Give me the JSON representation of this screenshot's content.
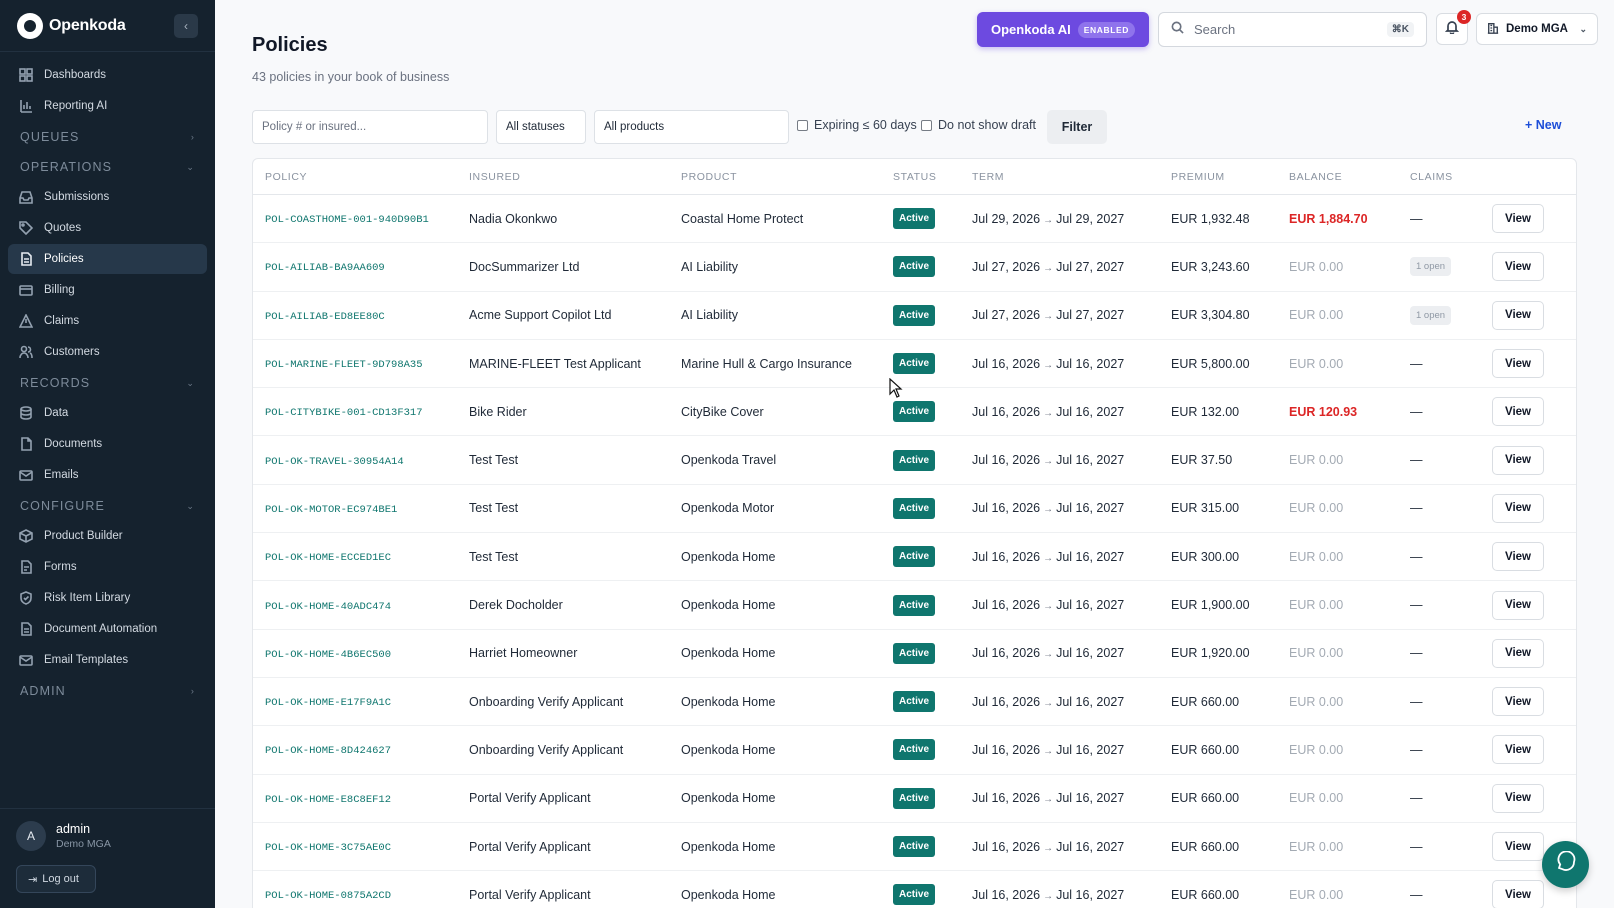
{
  "brand": {
    "name": "Openkoda"
  },
  "sidebar": {
    "top_items": [
      {
        "label": "Dashboards",
        "icon": "grid-icon"
      },
      {
        "label": "Reporting AI",
        "icon": "bar-chart-icon"
      }
    ],
    "sections": {
      "queues": "QUEUES",
      "operations": "OPERATIONS",
      "records": "RECORDS",
      "configure": "CONFIGURE",
      "admin": "ADMIN"
    },
    "operations_items": [
      {
        "label": "Submissions",
        "icon": "inbox-icon"
      },
      {
        "label": "Quotes",
        "icon": "tag-icon"
      },
      {
        "label": "Policies",
        "icon": "file-icon",
        "active": true
      },
      {
        "label": "Billing",
        "icon": "card-icon"
      },
      {
        "label": "Claims",
        "icon": "warning-icon"
      },
      {
        "label": "Customers",
        "icon": "users-icon"
      }
    ],
    "records_items": [
      {
        "label": "Data",
        "icon": "database-icon"
      },
      {
        "label": "Documents",
        "icon": "document-icon"
      },
      {
        "label": "Emails",
        "icon": "mail-icon"
      }
    ],
    "configure_items": [
      {
        "label": "Product Builder",
        "icon": "box-icon"
      },
      {
        "label": "Forms",
        "icon": "form-icon"
      },
      {
        "label": "Risk Item Library",
        "icon": "shield-icon"
      },
      {
        "label": "Document Automation",
        "icon": "doc-auto-icon"
      },
      {
        "label": "Email Templates",
        "icon": "mail-template-icon"
      }
    ],
    "user": {
      "initial": "A",
      "name": "admin",
      "org": "Demo MGA",
      "logout": "Log out"
    }
  },
  "header": {
    "title": "Policies",
    "subtitle": "43 policies in your book of business",
    "ai_button": "Openkoda AI",
    "ai_badge": "ENABLED",
    "search_placeholder": "Search",
    "search_shortcut": "⌘K",
    "notification_count": "3",
    "org_switcher": "Demo MGA"
  },
  "filters": {
    "search_placeholder": "Policy # or insured...",
    "status_select": "All statuses",
    "product_select": "All products",
    "expiring_label": "Expiring ≤ 60 days",
    "no_draft_label": "Do not show draft",
    "filter_button": "Filter",
    "new_button": "+ New"
  },
  "table": {
    "headers": [
      "POLICY",
      "INSURED",
      "PRODUCT",
      "STATUS",
      "TERM",
      "PREMIUM",
      "BALANCE",
      "CLAIMS"
    ],
    "view_label": "View",
    "rows": [
      {
        "policy": "POL-COASTHOME-001-940D90B1",
        "insured": "Nadia Okonkwo",
        "product": "Coastal Home Protect",
        "status": "Active",
        "start": "Jul 29, 2026",
        "end": "Jul 29, 2027",
        "premium": "EUR 1,932.48",
        "balance": "EUR 1,884.70",
        "balance_due": true,
        "claims": "—"
      },
      {
        "policy": "POL-AILIAB-BA9AA609",
        "insured": "DocSummarizer Ltd",
        "product": "AI Liability",
        "status": "Active",
        "start": "Jul 27, 2026",
        "end": "Jul 27, 2027",
        "premium": "EUR 3,243.60",
        "balance": "EUR 0.00",
        "balance_due": false,
        "claims": "1 open"
      },
      {
        "policy": "POL-AILIAB-ED8EE80C",
        "insured": "Acme Support Copilot Ltd",
        "product": "AI Liability",
        "status": "Active",
        "start": "Jul 27, 2026",
        "end": "Jul 27, 2027",
        "premium": "EUR 3,304.80",
        "balance": "EUR 0.00",
        "balance_due": false,
        "claims": "1 open"
      },
      {
        "policy": "POL-MARINE-FLEET-9D798A35",
        "insured": "MARINE-FLEET Test Applicant",
        "product": "Marine Hull & Cargo Insurance",
        "status": "Active",
        "start": "Jul 16, 2026",
        "end": "Jul 16, 2027",
        "premium": "EUR 5,800.00",
        "balance": "EUR 0.00",
        "balance_due": false,
        "claims": "—"
      },
      {
        "policy": "POL-CITYBIKE-001-CD13F317",
        "insured": "Bike Rider",
        "product": "CityBike Cover",
        "status": "Active",
        "start": "Jul 16, 2026",
        "end": "Jul 16, 2027",
        "premium": "EUR 132.00",
        "balance": "EUR 120.93",
        "balance_due": true,
        "claims": "—"
      },
      {
        "policy": "POL-OK-TRAVEL-30954A14",
        "insured": "Test Test",
        "product": "Openkoda Travel",
        "status": "Active",
        "start": "Jul 16, 2026",
        "end": "Jul 16, 2027",
        "premium": "EUR 37.50",
        "balance": "EUR 0.00",
        "balance_due": false,
        "claims": "—"
      },
      {
        "policy": "POL-OK-MOTOR-EC974BE1",
        "insured": "Test Test",
        "product": "Openkoda Motor",
        "status": "Active",
        "start": "Jul 16, 2026",
        "end": "Jul 16, 2027",
        "premium": "EUR 315.00",
        "balance": "EUR 0.00",
        "balance_due": false,
        "claims": "—"
      },
      {
        "policy": "POL-OK-HOME-ECCED1EC",
        "insured": "Test Test",
        "product": "Openkoda Home",
        "status": "Active",
        "start": "Jul 16, 2026",
        "end": "Jul 16, 2027",
        "premium": "EUR 300.00",
        "balance": "EUR 0.00",
        "balance_due": false,
        "claims": "—"
      },
      {
        "policy": "POL-OK-HOME-40ADC474",
        "insured": "Derek Docholder",
        "product": "Openkoda Home",
        "status": "Active",
        "start": "Jul 16, 2026",
        "end": "Jul 16, 2027",
        "premium": "EUR 1,900.00",
        "balance": "EUR 0.00",
        "balance_due": false,
        "claims": "—"
      },
      {
        "policy": "POL-OK-HOME-4B6EC500",
        "insured": "Harriet Homeowner",
        "product": "Openkoda Home",
        "status": "Active",
        "start": "Jul 16, 2026",
        "end": "Jul 16, 2027",
        "premium": "EUR 1,920.00",
        "balance": "EUR 0.00",
        "balance_due": false,
        "claims": "—"
      },
      {
        "policy": "POL-OK-HOME-E17F9A1C",
        "insured": "Onboarding Verify Applicant",
        "product": "Openkoda Home",
        "status": "Active",
        "start": "Jul 16, 2026",
        "end": "Jul 16, 2027",
        "premium": "EUR 660.00",
        "balance": "EUR 0.00",
        "balance_due": false,
        "claims": "—"
      },
      {
        "policy": "POL-OK-HOME-8D424627",
        "insured": "Onboarding Verify Applicant",
        "product": "Openkoda Home",
        "status": "Active",
        "start": "Jul 16, 2026",
        "end": "Jul 16, 2027",
        "premium": "EUR 660.00",
        "balance": "EUR 0.00",
        "balance_due": false,
        "claims": "—"
      },
      {
        "policy": "POL-OK-HOME-E8C8EF12",
        "insured": "Portal Verify Applicant",
        "product": "Openkoda Home",
        "status": "Active",
        "start": "Jul 16, 2026",
        "end": "Jul 16, 2027",
        "premium": "EUR 660.00",
        "balance": "EUR 0.00",
        "balance_due": false,
        "claims": "—"
      },
      {
        "policy": "POL-OK-HOME-3C75AE0C",
        "insured": "Portal Verify Applicant",
        "product": "Openkoda Home",
        "status": "Active",
        "start": "Jul 16, 2026",
        "end": "Jul 16, 2027",
        "premium": "EUR 660.00",
        "balance": "EUR 0.00",
        "balance_due": false,
        "claims": "—"
      },
      {
        "policy": "POL-OK-HOME-0875A2CD",
        "insured": "Portal Verify Applicant",
        "product": "Openkoda Home",
        "status": "Active",
        "start": "Jul 16, 2026",
        "end": "Jul 16, 2027",
        "premium": "EUR 660.00",
        "balance": "EUR 0.00",
        "balance_due": false,
        "claims": "—"
      }
    ]
  }
}
